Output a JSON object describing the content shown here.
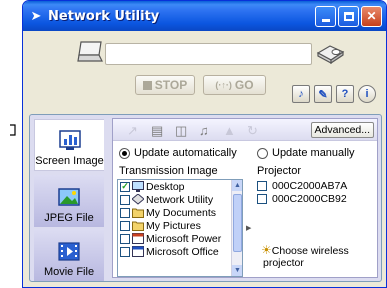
{
  "window": {
    "title": "Network Utility",
    "title_icon": "diamond-arrow-icon"
  },
  "controls": {
    "stop_label": "STOP",
    "go_label": "GO",
    "go_signal_glyph": "(·↑·)"
  },
  "help_buttons": [
    {
      "name": "projector-settings-button",
      "glyph": "♪"
    },
    {
      "name": "tools-button",
      "glyph": "✎"
    },
    {
      "name": "help-button",
      "glyph": "?"
    },
    {
      "name": "info-button",
      "glyph": "i"
    }
  ],
  "nav": {
    "screen_image": "Screen Image",
    "jpeg_file": "JPEG File",
    "movie_file": "Movie File"
  },
  "toolbar": {
    "advanced_label": "Advanced..."
  },
  "options": {
    "update_auto": "Update automatically",
    "update_manual": "Update manually"
  },
  "transmission": {
    "header": "Transmission Image",
    "items": [
      {
        "label": "Desktop",
        "checked": true
      },
      {
        "label": "Network Utility",
        "checked": false
      },
      {
        "label": "My Documents",
        "checked": false
      },
      {
        "label": "My Pictures",
        "checked": false
      },
      {
        "label": "Microsoft Power",
        "checked": false
      },
      {
        "label": "Microsoft Office",
        "checked": false
      }
    ]
  },
  "projector": {
    "header": "Projector",
    "items": [
      {
        "label": "000C2000AB7A",
        "checked": false
      },
      {
        "label": "000C2000CB92",
        "checked": false
      }
    ],
    "choose_text_1": "Choose wireless",
    "choose_text_2": "projector"
  },
  "colors": {
    "titlebar": "#0a56e0",
    "window_bg": "#ece9d8",
    "pane_bg": "#dcdcf0",
    "disabled_text": "#aca899"
  }
}
